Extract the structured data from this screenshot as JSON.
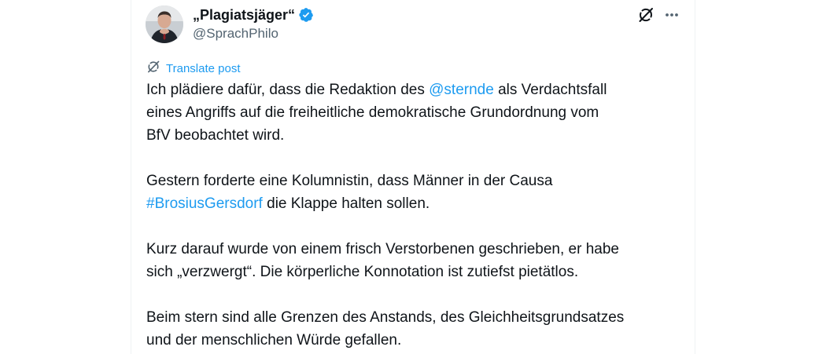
{
  "author": {
    "display_name": "„Plagiatsjäger“",
    "handle": "@SprachPhilo",
    "verified": true
  },
  "actions": {
    "grok_icon": "grok-icon",
    "more_icon": "more-icon"
  },
  "translate": {
    "label": "Translate post"
  },
  "post": {
    "p1_before": "Ich plädiere dafür, dass die Redaktion des ",
    "p1_mention": "@sternde",
    "p1_after": " als Verdachtsfall",
    "p1_line2": "eines Angriffs auf die freiheitliche demokratische Grundordnung vom",
    "p1_line3": "BfV beobachtet wird.",
    "p2_line1": "Gestern forderte eine Kolumnistin, dass Männer in der Causa",
    "p2_hashtag": "#BrosiusGersdorf",
    "p2_after": " die Klappe halten sollen.",
    "p3_line1": "Kurz darauf wurde von einem frisch Verstorbenen geschrieben, er habe",
    "p3_line2": "sich „verzwergt“. Die körperliche Konnotation ist zutiefst pietätlos.",
    "p4_line1": "Beim stern sind alle Grenzen des Anstands, des Gleichheitsgrundsatzes",
    "p4_line2": "und der menschlichen Würde gefallen."
  },
  "colors": {
    "link": "#1d9bf0",
    "text": "#0f1419",
    "secondary": "#536471"
  }
}
